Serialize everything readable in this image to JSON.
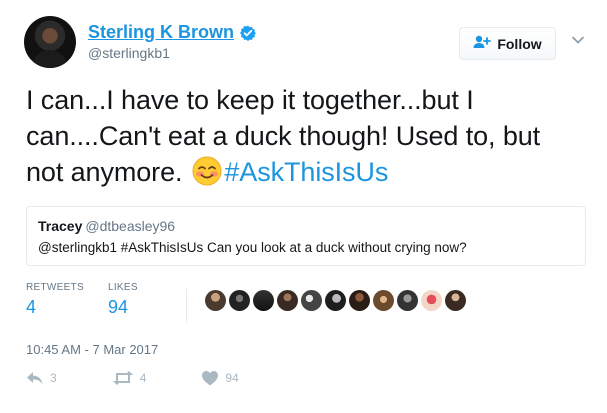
{
  "author": {
    "name": "Sterling K Brown",
    "handle": "@sterlingkb1"
  },
  "header": {
    "follow_label": "Follow"
  },
  "tweet": {
    "text_part1": "I can...I have to keep it together...but I can....Can't eat a duck though! Used to, but not anymore.",
    "hashtag": "#AskThisIsUs"
  },
  "quote": {
    "name": "Tracey",
    "handle": "@dtbeasley96",
    "text": "@sterlingkb1 #AskThisIsUs Can you look at a duck without crying now?"
  },
  "stats": {
    "retweets_label": "RETWEETS",
    "retweets_value": "4",
    "likes_label": "LIKES",
    "likes_value": "94"
  },
  "timestamp": "10:45 AM - 7 Mar 2017",
  "actions": {
    "reply_count": "3",
    "retweet_count": "4",
    "like_count": "94"
  },
  "colors": {
    "accent": "#1b95e0",
    "muted": "#657786",
    "border": "#e6ecf0"
  },
  "icons": {
    "verified": "verified-icon",
    "follow": "add-user-icon",
    "caret": "chevron-down-icon",
    "reply": "reply-icon",
    "retweet": "retweet-icon",
    "like": "heart-icon",
    "emoji": "smiling-face-with-smiling-eyes-emoji"
  }
}
